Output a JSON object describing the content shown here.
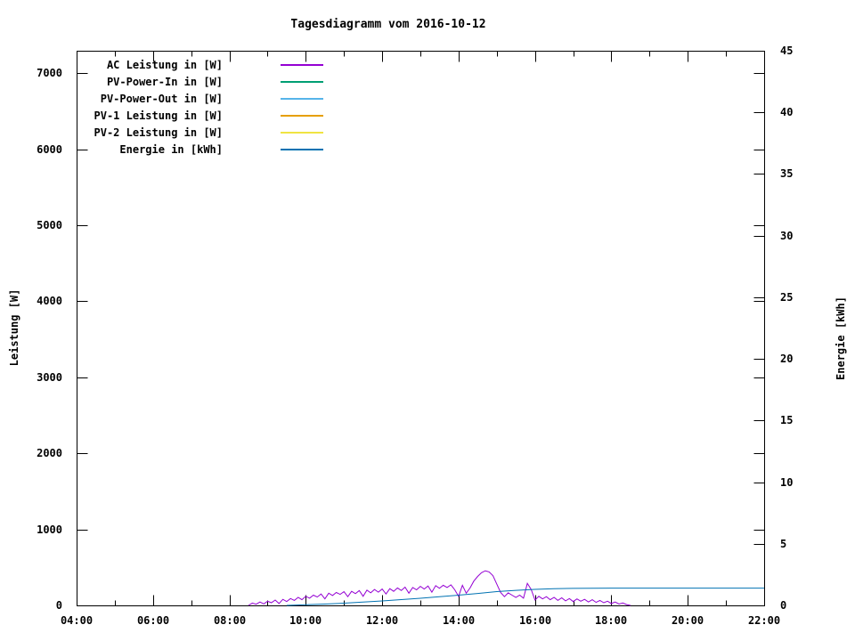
{
  "chart_data": {
    "type": "line",
    "title": "Tagesdiagramm vom 2016-10-12",
    "ylabel": "Leistung [W]",
    "y2label": "Energie [kWh]",
    "x_range_hours": [
      4,
      22
    ],
    "x_tick_hours": [
      4,
      6,
      8,
      10,
      12,
      14,
      16,
      18,
      20,
      22
    ],
    "x_tick_labels": [
      "04:00",
      "06:00",
      "08:00",
      "10:00",
      "12:00",
      "14:00",
      "16:00",
      "18:00",
      "20:00",
      "22:00"
    ],
    "x_minor_hours": [
      5,
      7,
      9,
      11,
      13,
      15,
      17,
      19,
      21
    ],
    "y1_range": [
      0,
      7295
    ],
    "y1_ticks": [
      0,
      1000,
      2000,
      3000,
      4000,
      5000,
      6000,
      7000
    ],
    "y2_range": [
      0,
      45
    ],
    "y2_ticks": [
      0,
      5,
      10,
      15,
      20,
      25,
      30,
      35,
      40,
      45
    ],
    "grid": false,
    "legend_position": "top-left",
    "background": "#ffffff",
    "axis_color": "#000000",
    "series": [
      {
        "name": "AC Leistung in [W]",
        "color": "#9400d3",
        "axis": "y1",
        "points": [
          [
            8.5,
            0
          ],
          [
            8.6,
            30
          ],
          [
            8.7,
            15
          ],
          [
            8.8,
            45
          ],
          [
            8.9,
            20
          ],
          [
            9.0,
            55
          ],
          [
            9.1,
            35
          ],
          [
            9.2,
            70
          ],
          [
            9.3,
            25
          ],
          [
            9.4,
            80
          ],
          [
            9.5,
            50
          ],
          [
            9.6,
            90
          ],
          [
            9.7,
            65
          ],
          [
            9.8,
            105
          ],
          [
            9.9,
            75
          ],
          [
            10.0,
            120
          ],
          [
            10.1,
            95
          ],
          [
            10.2,
            135
          ],
          [
            10.3,
            110
          ],
          [
            10.4,
            150
          ],
          [
            10.5,
            85
          ],
          [
            10.6,
            160
          ],
          [
            10.7,
            130
          ],
          [
            10.8,
            170
          ],
          [
            10.9,
            145
          ],
          [
            11.0,
            180
          ],
          [
            11.1,
            115
          ],
          [
            11.2,
            185
          ],
          [
            11.3,
            155
          ],
          [
            11.4,
            195
          ],
          [
            11.5,
            120
          ],
          [
            11.6,
            200
          ],
          [
            11.7,
            165
          ],
          [
            11.8,
            210
          ],
          [
            11.9,
            175
          ],
          [
            12.0,
            215
          ],
          [
            12.1,
            150
          ],
          [
            12.2,
            220
          ],
          [
            12.3,
            185
          ],
          [
            12.4,
            230
          ],
          [
            12.5,
            195
          ],
          [
            12.6,
            240
          ],
          [
            12.7,
            160
          ],
          [
            12.8,
            235
          ],
          [
            12.9,
            205
          ],
          [
            13.0,
            250
          ],
          [
            13.1,
            215
          ],
          [
            13.2,
            255
          ],
          [
            13.3,
            175
          ],
          [
            13.4,
            260
          ],
          [
            13.5,
            225
          ],
          [
            13.6,
            265
          ],
          [
            13.7,
            235
          ],
          [
            13.8,
            270
          ],
          [
            13.9,
            205
          ],
          [
            14.0,
            120
          ],
          [
            14.1,
            265
          ],
          [
            14.2,
            160
          ],
          [
            14.3,
            230
          ],
          [
            14.4,
            320
          ],
          [
            14.5,
            380
          ],
          [
            14.6,
            430
          ],
          [
            14.7,
            455
          ],
          [
            14.8,
            440
          ],
          [
            14.9,
            390
          ],
          [
            15.0,
            280
          ],
          [
            15.1,
            170
          ],
          [
            15.2,
            115
          ],
          [
            15.3,
            165
          ],
          [
            15.4,
            135
          ],
          [
            15.5,
            105
          ],
          [
            15.6,
            135
          ],
          [
            15.7,
            95
          ],
          [
            15.8,
            290
          ],
          [
            15.9,
            210
          ],
          [
            16.0,
            70
          ],
          [
            16.1,
            120
          ],
          [
            16.2,
            85
          ],
          [
            16.3,
            115
          ],
          [
            16.4,
            75
          ],
          [
            16.5,
            105
          ],
          [
            16.6,
            65
          ],
          [
            16.7,
            100
          ],
          [
            16.8,
            60
          ],
          [
            16.9,
            90
          ],
          [
            17.0,
            50
          ],
          [
            17.1,
            85
          ],
          [
            17.2,
            55
          ],
          [
            17.3,
            80
          ],
          [
            17.4,
            45
          ],
          [
            17.5,
            75
          ],
          [
            17.6,
            40
          ],
          [
            17.7,
            65
          ],
          [
            17.8,
            35
          ],
          [
            17.9,
            55
          ],
          [
            18.0,
            25
          ],
          [
            18.1,
            45
          ],
          [
            18.2,
            18
          ],
          [
            18.3,
            32
          ],
          [
            18.4,
            10
          ],
          [
            18.5,
            0
          ]
        ]
      },
      {
        "name": "PV-Power-In in [W]",
        "color": "#009e73",
        "axis": "y1",
        "points": []
      },
      {
        "name": "PV-Power-Out in [W]",
        "color": "#56b4e9",
        "axis": "y1",
        "points": []
      },
      {
        "name": "PV-1 Leistung in [W]",
        "color": "#e69f00",
        "axis": "y1",
        "points": []
      },
      {
        "name": "PV-2 Leistung in [W]",
        "color": "#f0e442",
        "axis": "y1",
        "points": []
      },
      {
        "name": "Energie in [kWh]",
        "color": "#0072b2",
        "axis": "y2",
        "points": [
          [
            9.5,
            0
          ],
          [
            10.0,
            0.05
          ],
          [
            10.5,
            0.11
          ],
          [
            11.0,
            0.18
          ],
          [
            11.5,
            0.27
          ],
          [
            12.0,
            0.36
          ],
          [
            12.5,
            0.47
          ],
          [
            13.0,
            0.58
          ],
          [
            13.5,
            0.7
          ],
          [
            14.0,
            0.83
          ],
          [
            14.5,
            0.97
          ],
          [
            15.0,
            1.12
          ],
          [
            15.5,
            1.22
          ],
          [
            16.0,
            1.3
          ],
          [
            16.5,
            1.35
          ],
          [
            17.0,
            1.38
          ],
          [
            17.5,
            1.39
          ],
          [
            18.0,
            1.4
          ],
          [
            19.0,
            1.4
          ],
          [
            20.0,
            1.4
          ],
          [
            21.0,
            1.4
          ],
          [
            22.0,
            1.4
          ]
        ]
      }
    ]
  }
}
